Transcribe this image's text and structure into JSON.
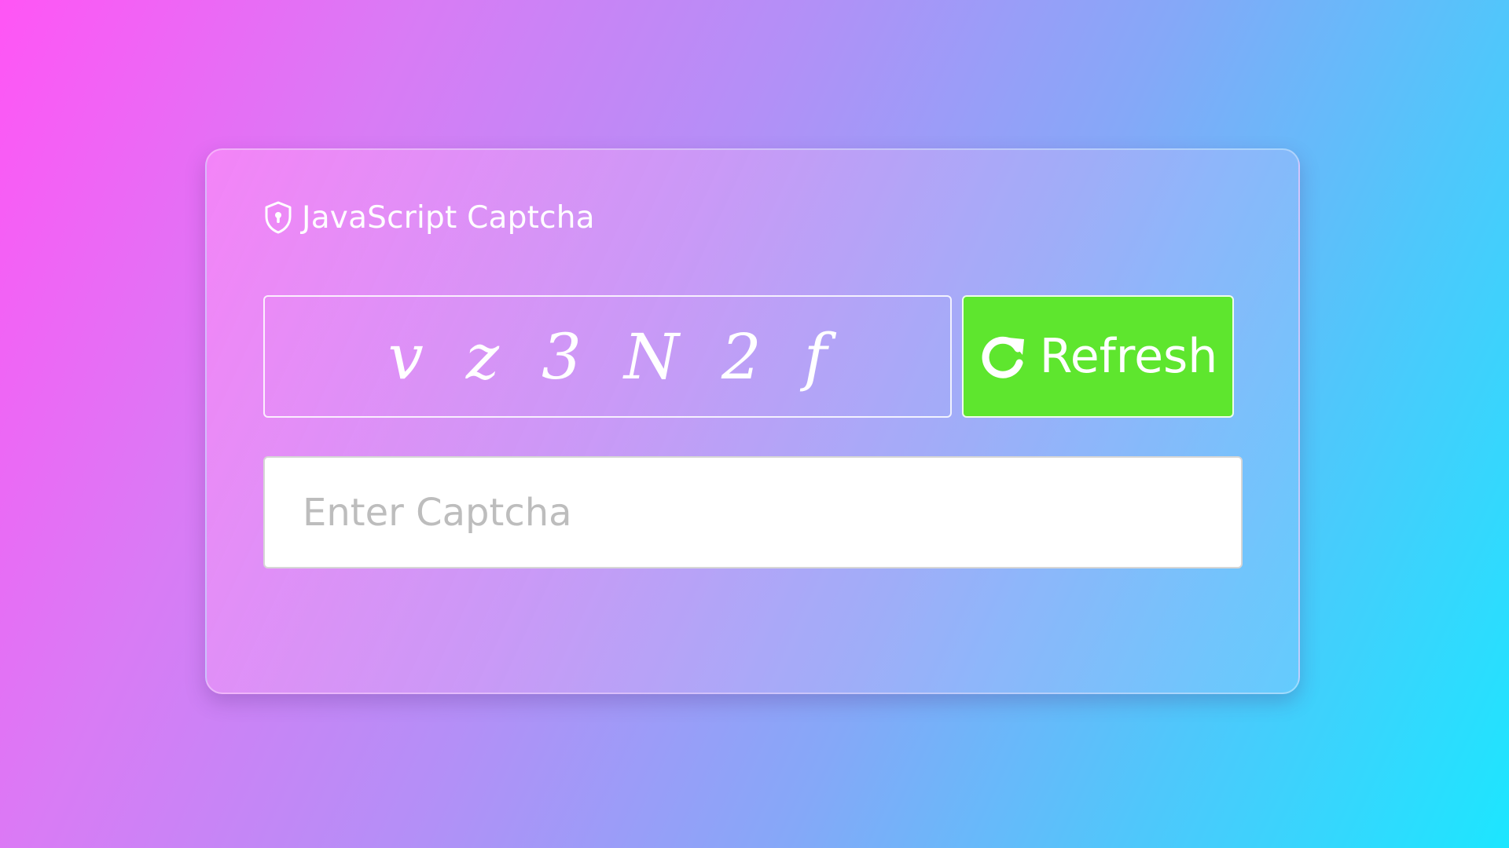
{
  "card": {
    "title": "JavaScript Captcha",
    "title_icon": "shield-lock-icon"
  },
  "captcha": {
    "text": "vz3N2f"
  },
  "refresh_button": {
    "label": "Refresh",
    "icon": "refresh-icon",
    "color": "#5ee62e"
  },
  "input": {
    "value": "",
    "placeholder": "Enter Captcha"
  },
  "colors": {
    "background_start": "#ff55f5",
    "background_end": "#1ce6ff"
  }
}
